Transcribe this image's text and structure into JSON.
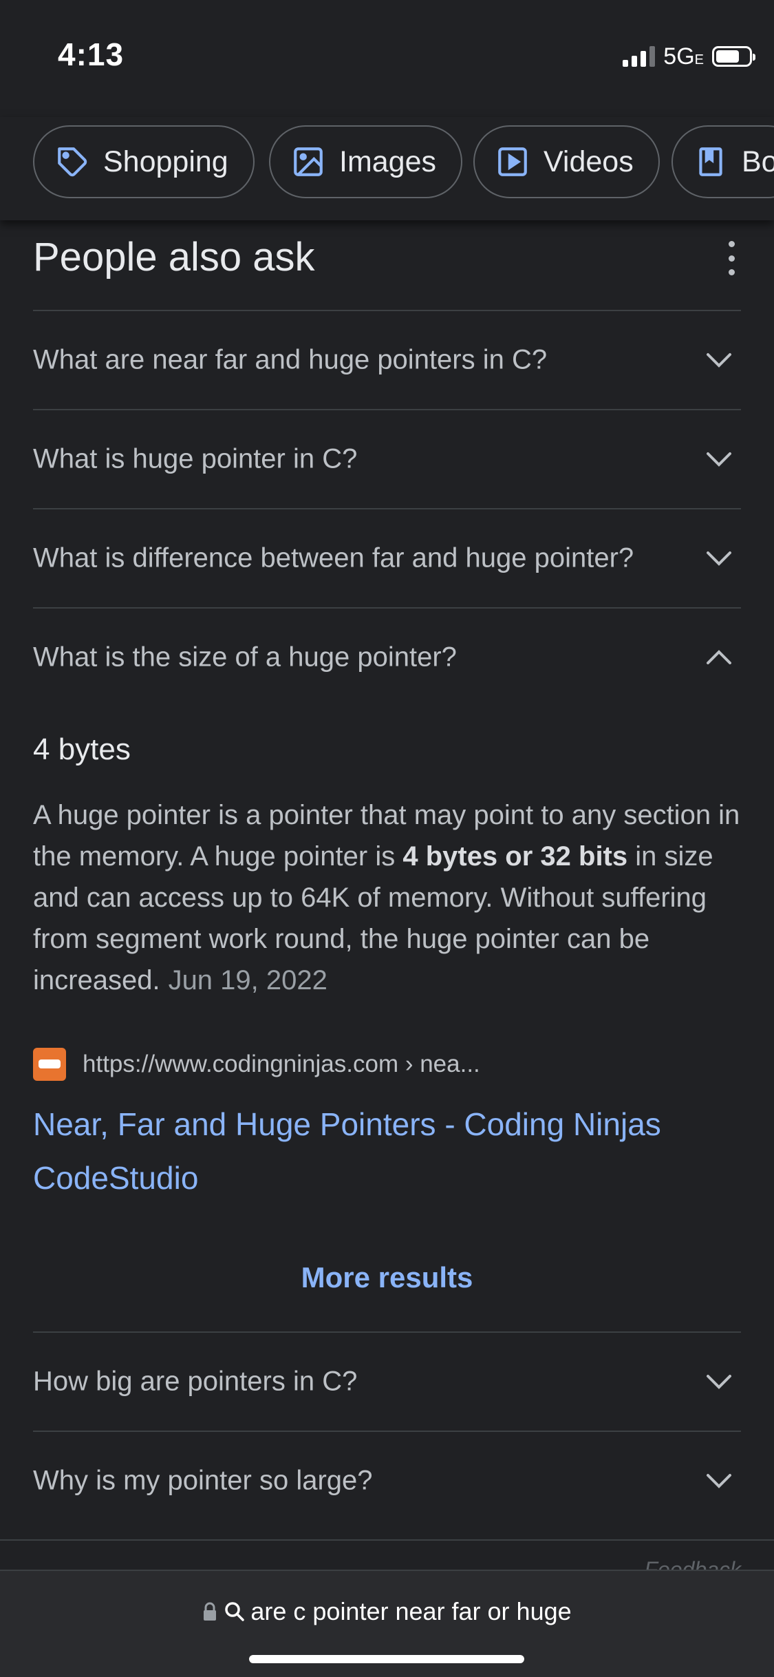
{
  "status_bar": {
    "time": "4:13",
    "network": "5G",
    "network_sub": "E",
    "battery_level": 0.72
  },
  "filter_chips": [
    {
      "label": "Shopping",
      "icon": "tag-icon"
    },
    {
      "label": "Images",
      "icon": "image-icon"
    },
    {
      "label": "Videos",
      "icon": "play-icon"
    },
    {
      "label": "Bo",
      "icon": "book-icon"
    }
  ],
  "people_also_ask": {
    "title": "People also ask",
    "questions_before": [
      {
        "text": "What are near far and huge pointers in C?",
        "expanded": false
      },
      {
        "text": "What is huge pointer in C?",
        "expanded": false
      },
      {
        "text": "What is difference between far and huge pointer?",
        "expanded": false
      },
      {
        "text": "What is the size of a huge pointer?",
        "expanded": true
      }
    ],
    "answer": {
      "short": "4 bytes",
      "body_pre": "A huge pointer is a pointer that may point to any section in the memory. A huge pointer is ",
      "body_bold": "4 bytes or 32 bits",
      "body_post": " in size and can access up to 64K of memory. Without suffering from segment work round, the huge pointer can be increased.",
      "date": "Jun 19, 2022",
      "source_url": "https://www.codingninjas.com › nea...",
      "source_title": "Near, Far and Huge Pointers - Coding Ninjas CodeStudio"
    },
    "more_results": "More results",
    "questions_after": [
      {
        "text": "How big are pointers in C?",
        "expanded": false
      },
      {
        "text": "Why is my pointer so large?",
        "expanded": false
      }
    ],
    "feedback": "Feedback"
  },
  "address_bar": {
    "query": "are c pointer near far or huge"
  },
  "colors": {
    "background": "#202124",
    "link": "#8ab4f8",
    "divider": "#3c4043",
    "favicon": "#e8742f"
  }
}
